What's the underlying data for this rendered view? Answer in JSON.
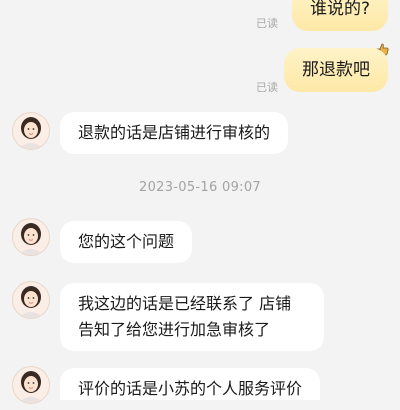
{
  "messages": {
    "user_1": {
      "text": "谁说的?",
      "status": "已读"
    },
    "user_2": {
      "text": "那退款吧",
      "status": "已读"
    },
    "agent_1": {
      "text": "退款的话是店铺进行审核的"
    },
    "timestamp": "2023-05-16 09:07",
    "agent_2": {
      "text": "您的这个问题"
    },
    "agent_3": {
      "text": "我这边的话是已经联系了 店铺告知了给您进行加急审核了"
    },
    "agent_4": {
      "text": "评价的话是小苏的个人服务评价"
    }
  },
  "colors": {
    "user_bubble": "#fde8a6",
    "agent_bubble": "#ffffff",
    "background": "#f3f3f3"
  },
  "icons": {
    "avatar": "agent-avatar",
    "sticker": "thumbs-up-sticker"
  }
}
